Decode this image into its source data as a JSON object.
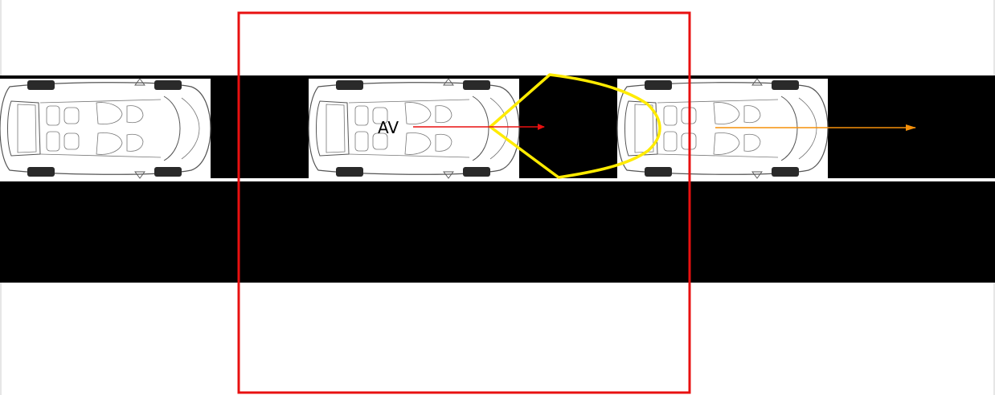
{
  "scene": {
    "label": "AV",
    "colors": {
      "background": "#ffffff",
      "road": "#000000",
      "lane_marking": "#ffffff",
      "roi_box": "#e81010",
      "sensor_region": "#ffeb00",
      "ego_velocity": "#e81010",
      "lead_velocity": "#f5900a",
      "car_outline": "#555555",
      "wheel": "#2a2a2a"
    },
    "vehicles": [
      {
        "id": "rear-car",
        "role": "follower"
      },
      {
        "id": "ego-car",
        "role": "autonomous",
        "label_ref": "label"
      },
      {
        "id": "lead-car",
        "role": "leader"
      }
    ]
  }
}
